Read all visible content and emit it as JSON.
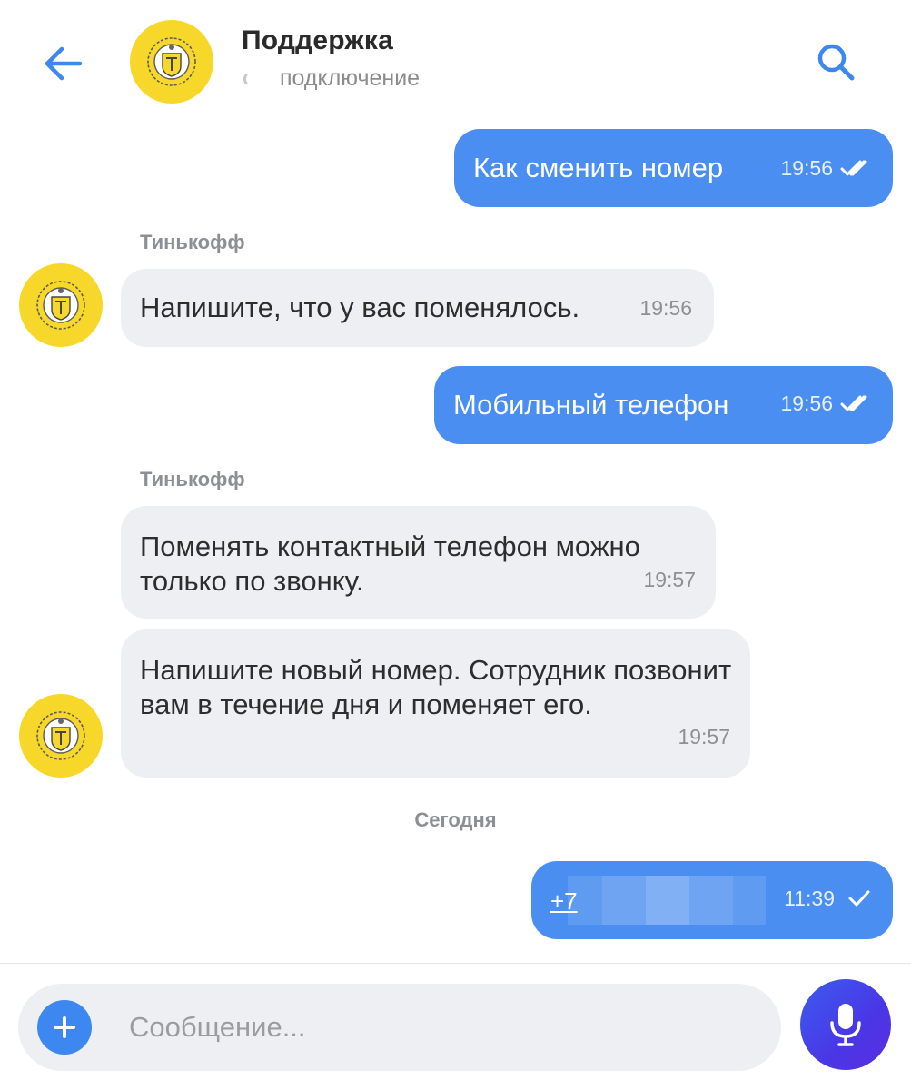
{
  "header": {
    "title": "Поддержка",
    "status": "подключение"
  },
  "messages": [
    {
      "direction": "out",
      "text": "Как сменить номер",
      "time": "19:56",
      "status": "read"
    },
    {
      "direction": "in",
      "sender": "Тинькофф",
      "text": "Напишите, что у вас поменялось.",
      "time": "19:56"
    },
    {
      "direction": "out",
      "text": "Мобильный телефон",
      "time": "19:56",
      "status": "read"
    },
    {
      "direction": "in",
      "sender": "Тинькофф",
      "text": "Поменять контактный телефон можно только по звонку.",
      "time": "19:57"
    },
    {
      "direction": "in",
      "text": "Напишите новый номер. Сотрудник позвонит вам в течение дня и поменяет его.",
      "time": "19:57"
    },
    {
      "direction": "out",
      "text": "+7",
      "time": "11:39",
      "status": "sent",
      "redacted": true
    }
  ],
  "date_divider": "Сегодня",
  "composer": {
    "placeholder": "Сообщение..."
  },
  "colors": {
    "outgoing_bubble": "#4b8ef1",
    "incoming_bubble": "#eeeff2",
    "accent": "#3c88f0",
    "avatar_yellow": "#f7d82a",
    "mic_button": "#4a36e6"
  },
  "icons": {
    "back": "arrow-left-icon",
    "search": "search-icon",
    "attach": "plus-icon",
    "mic": "microphone-icon",
    "read": "double-check-icon",
    "sent": "check-icon"
  }
}
